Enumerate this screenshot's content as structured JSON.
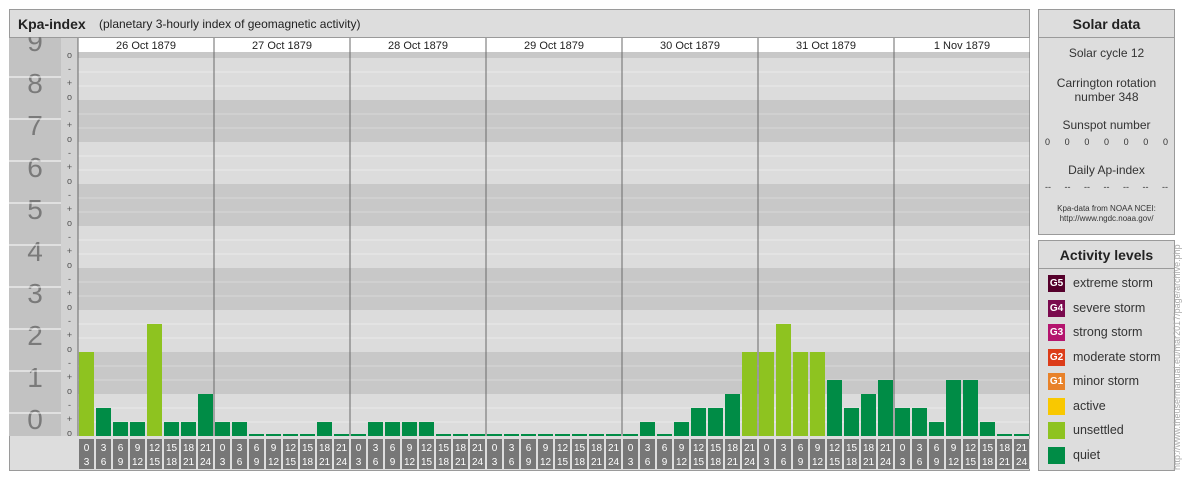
{
  "header": {
    "title": "Kpa-index",
    "subtitle": "(planetary 3-hourly index of geomagnetic activity)"
  },
  "solar_data": {
    "title": "Solar data",
    "solar_cycle": "Solar cycle 12",
    "carrington_line1": "Carrington rotation",
    "carrington_line2": "number 348",
    "sunspot_label": "Sunspot number",
    "sunspot_values": [
      "0",
      "0",
      "0",
      "0",
      "0",
      "0",
      "0"
    ],
    "ap_label": "Daily Ap-index",
    "ap_values": [
      "--",
      "--",
      "--",
      "--",
      "--",
      "--",
      "--"
    ],
    "source_line1": "Kpa-data from NOAA NCEI:",
    "source_line2": "http://www.ngdc.noaa.gov/"
  },
  "activity_levels": {
    "title": "Activity levels",
    "items": [
      {
        "badge": "G5",
        "label": "extreme storm",
        "color": "#55002b"
      },
      {
        "badge": "G4",
        "label": "severe storm",
        "color": "#7a0a4e"
      },
      {
        "badge": "G3",
        "label": "strong storm",
        "color": "#b4146e"
      },
      {
        "badge": "G2",
        "label": "moderate storm",
        "color": "#dc3c19"
      },
      {
        "badge": "G1",
        "label": "minor storm",
        "color": "#e8822a"
      },
      {
        "badge": "",
        "label": "active",
        "color": "#f9c800"
      },
      {
        "badge": "",
        "label": "unsettled",
        "color": "#8ec320"
      },
      {
        "badge": "",
        "label": "quiet",
        "color": "#008c46"
      }
    ]
  },
  "watermark": "http://www.theusermanual.eu/mar2017/page/archive.php",
  "chart_data": {
    "type": "bar",
    "title": "Kpa-index",
    "ylim": [
      0,
      9
    ],
    "y_ticks": [
      "0",
      "1",
      "2",
      "3",
      "4",
      "5",
      "6",
      "7",
      "8",
      "9"
    ],
    "minor_marks": [
      "o",
      "+",
      "-"
    ],
    "days": [
      "26 Oct 1879",
      "27 Oct 1879",
      "28 Oct 1879",
      "29 Oct 1879",
      "30 Oct 1879",
      "31 Oct 1879",
      "1 Nov 1879"
    ],
    "hour_labels_top": [
      "0",
      "3",
      "6",
      "9",
      "12",
      "15",
      "18",
      "21"
    ],
    "hour_labels_bottom": [
      "3",
      "6",
      "9",
      "12",
      "15",
      "18",
      "21",
      "24"
    ],
    "values": [
      [
        2.0,
        0.667,
        0.333,
        0.333,
        2.667,
        0.333,
        0.333,
        1.0
      ],
      [
        0.333,
        0.333,
        0,
        0,
        0,
        0,
        0.333,
        0
      ],
      [
        0,
        0.333,
        0.333,
        0.333,
        0.333,
        0,
        0,
        0
      ],
      [
        0,
        0,
        0,
        0,
        0,
        0,
        0,
        0
      ],
      [
        0,
        0.333,
        0,
        0.333,
        0.667,
        0.667,
        1.0,
        2.0
      ],
      [
        2.0,
        2.667,
        2.0,
        2.0,
        1.333,
        0.667,
        1.0,
        1.333
      ],
      [
        0.667,
        0.667,
        0.333,
        1.333,
        1.333,
        0.333,
        0,
        0
      ]
    ],
    "colors": {
      "quiet": "#008c46",
      "unsettled": "#8ec320",
      "active": "#f9c800"
    }
  }
}
